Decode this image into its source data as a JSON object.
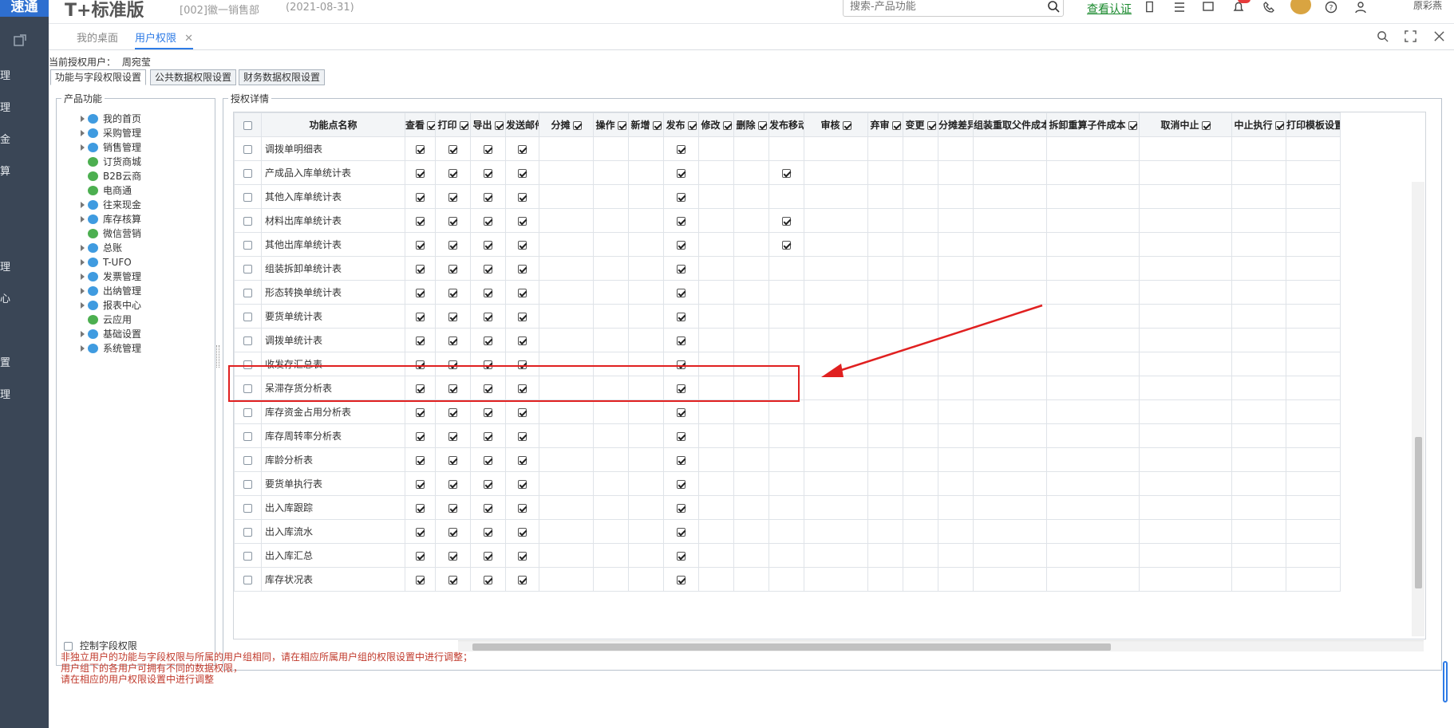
{
  "brand": {
    "logo_text": "速通",
    "title": "T+标准版",
    "account": "[002]徽一销售部",
    "date": "(2021-08-31)"
  },
  "search": {
    "placeholder": "搜索-产品功能",
    "link": "查看认证",
    "user": "原彩燕"
  },
  "left_nav": [
    "理",
    "理",
    "金",
    "算",
    "理",
    "心",
    "置",
    "理"
  ],
  "tabs": [
    {
      "label": "我的桌面"
    },
    {
      "label": "用户权限"
    }
  ],
  "current_user": {
    "label": "当前授权用户：",
    "name": "周宛莹"
  },
  "settings_tabs": [
    "功能与字段权限设置",
    "公共数据权限设置",
    "财务数据权限设置"
  ],
  "product_panel": {
    "title": "产品功能"
  },
  "tree": [
    {
      "label": "我的首页",
      "expandable": true
    },
    {
      "label": "采购管理",
      "expandable": true
    },
    {
      "label": "销售管理",
      "expandable": true
    },
    {
      "label": "订货商城",
      "expandable": false
    },
    {
      "label": "B2B云商",
      "expandable": false
    },
    {
      "label": "电商通",
      "expandable": false
    },
    {
      "label": "往来现金",
      "expandable": true
    },
    {
      "label": "库存核算",
      "expandable": true
    },
    {
      "label": "微信营销",
      "expandable": false
    },
    {
      "label": "总账",
      "expandable": true
    },
    {
      "label": "T-UFO",
      "expandable": true
    },
    {
      "label": "发票管理",
      "expandable": true
    },
    {
      "label": "出纳管理",
      "expandable": true
    },
    {
      "label": "报表中心",
      "expandable": true
    },
    {
      "label": "云应用",
      "expandable": false
    },
    {
      "label": "基础设置",
      "expandable": true
    },
    {
      "label": "系统管理",
      "expandable": true
    }
  ],
  "detail_panel": {
    "title": "授权详情"
  },
  "grid": {
    "name_header": "功能点名称",
    "columns": [
      "查看",
      "打印",
      "导出",
      "发送邮件",
      "分摊",
      "操作",
      "新增",
      "发布",
      "修改",
      "删除",
      "发布移动端",
      "审核",
      "弃审",
      "变更",
      "分摊差异金额",
      "组装重取父件成本",
      "拆卸重算子件成本",
      "取消中止",
      "中止执行",
      "打印模板设置"
    ],
    "rows": [
      {
        "name": "调拨单明细表",
        "checks": [
          1,
          1,
          1,
          1,
          0,
          0,
          0,
          1,
          0,
          0,
          0,
          0,
          0,
          0,
          0,
          0,
          0,
          0,
          0,
          0
        ]
      },
      {
        "name": "产成品入库单统计表",
        "checks": [
          1,
          1,
          1,
          1,
          0,
          0,
          0,
          1,
          0,
          0,
          1,
          0,
          0,
          0,
          0,
          0,
          0,
          0,
          0,
          0
        ]
      },
      {
        "name": "其他入库单统计表",
        "checks": [
          1,
          1,
          1,
          1,
          0,
          0,
          0,
          1,
          0,
          0,
          0,
          0,
          0,
          0,
          0,
          0,
          0,
          0,
          0,
          0
        ]
      },
      {
        "name": "材料出库单统计表",
        "checks": [
          1,
          1,
          1,
          1,
          0,
          0,
          0,
          1,
          0,
          0,
          1,
          0,
          0,
          0,
          0,
          0,
          0,
          0,
          0,
          0
        ]
      },
      {
        "name": "其他出库单统计表",
        "checks": [
          1,
          1,
          1,
          1,
          0,
          0,
          0,
          1,
          0,
          0,
          1,
          0,
          0,
          0,
          0,
          0,
          0,
          0,
          0,
          0
        ]
      },
      {
        "name": "组装拆卸单统计表",
        "checks": [
          1,
          1,
          1,
          1,
          0,
          0,
          0,
          1,
          0,
          0,
          0,
          0,
          0,
          0,
          0,
          0,
          0,
          0,
          0,
          0
        ]
      },
      {
        "name": "形态转换单统计表",
        "checks": [
          1,
          1,
          1,
          1,
          0,
          0,
          0,
          1,
          0,
          0,
          0,
          0,
          0,
          0,
          0,
          0,
          0,
          0,
          0,
          0
        ]
      },
      {
        "name": "要货单统计表",
        "checks": [
          1,
          1,
          1,
          1,
          0,
          0,
          0,
          1,
          0,
          0,
          0,
          0,
          0,
          0,
          0,
          0,
          0,
          0,
          0,
          0
        ]
      },
      {
        "name": "调拨单统计表",
        "checks": [
          1,
          1,
          1,
          1,
          0,
          0,
          0,
          1,
          0,
          0,
          0,
          0,
          0,
          0,
          0,
          0,
          0,
          0,
          0,
          0
        ]
      },
      {
        "name": "收发存汇总表",
        "checks": [
          1,
          1,
          1,
          1,
          0,
          0,
          0,
          1,
          0,
          0,
          0,
          0,
          0,
          0,
          0,
          0,
          0,
          0,
          0,
          0
        ]
      },
      {
        "name": "呆滞存货分析表",
        "checks": [
          1,
          1,
          1,
          1,
          0,
          0,
          0,
          1,
          0,
          0,
          0,
          0,
          0,
          0,
          0,
          0,
          0,
          0,
          0,
          0
        ]
      },
      {
        "name": "库存资金占用分析表",
        "checks": [
          1,
          1,
          1,
          1,
          0,
          0,
          0,
          1,
          0,
          0,
          0,
          0,
          0,
          0,
          0,
          0,
          0,
          0,
          0,
          0
        ]
      },
      {
        "name": "库存周转率分析表",
        "checks": [
          1,
          1,
          1,
          1,
          0,
          0,
          0,
          1,
          0,
          0,
          0,
          0,
          0,
          0,
          0,
          0,
          0,
          0,
          0,
          0
        ]
      },
      {
        "name": "库龄分析表",
        "checks": [
          1,
          1,
          1,
          1,
          0,
          0,
          0,
          1,
          0,
          0,
          0,
          0,
          0,
          0,
          0,
          0,
          0,
          0,
          0,
          0
        ]
      },
      {
        "name": "要货单执行表",
        "checks": [
          1,
          1,
          1,
          1,
          0,
          0,
          0,
          1,
          0,
          0,
          0,
          0,
          0,
          0,
          0,
          0,
          0,
          0,
          0,
          0
        ]
      },
      {
        "name": "出入库跟踪",
        "checks": [
          1,
          1,
          1,
          1,
          0,
          0,
          0,
          1,
          0,
          0,
          0,
          0,
          0,
          0,
          0,
          0,
          0,
          0,
          0,
          0
        ]
      },
      {
        "name": "出入库流水",
        "checks": [
          1,
          1,
          1,
          1,
          0,
          0,
          0,
          1,
          0,
          0,
          0,
          0,
          0,
          0,
          0,
          0,
          0,
          0,
          0,
          0
        ]
      },
      {
        "name": "出入库汇总",
        "checks": [
          1,
          1,
          1,
          1,
          0,
          0,
          0,
          1,
          0,
          0,
          0,
          0,
          0,
          0,
          0,
          0,
          0,
          0,
          0,
          0
        ]
      },
      {
        "name": "库存状况表",
        "checks": [
          1,
          1,
          1,
          1,
          0,
          0,
          0,
          1,
          0,
          0,
          0,
          0,
          0,
          0,
          0,
          0,
          0,
          0,
          0,
          0
        ]
      }
    ]
  },
  "footer": {
    "control_label": "控制字段权限",
    "notes": [
      "非独立用户的功能与字段权限与所属的用户组相同，请在相应所属用户组的权限设置中进行调整；",
      "用户组下的各用户可拥有不同的数据权限，",
      "请在相应的用户权限设置中进行调整"
    ]
  },
  "colors": {
    "accent": "#2e7be6",
    "note": "#c0392b",
    "highlight": "#e02020",
    "sidebar": "#3a4656"
  }
}
